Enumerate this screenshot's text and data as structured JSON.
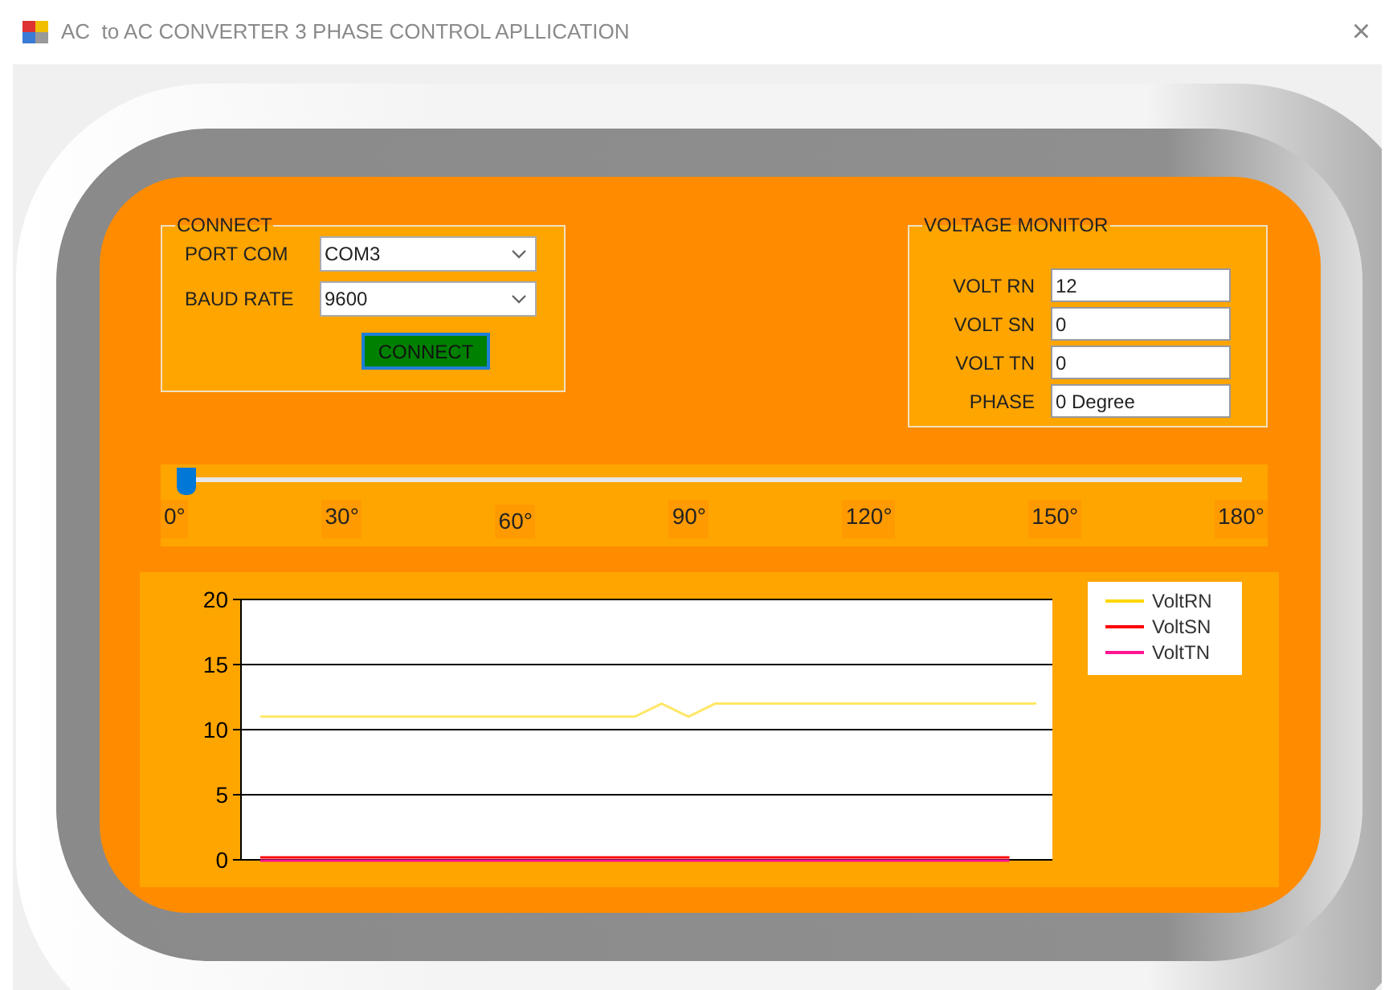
{
  "window": {
    "title": "AC  to AC CONVERTER 3 PHASE CONTROL APLLICATION",
    "close": "×"
  },
  "connect": {
    "title": "CONNECT",
    "fields": [
      {
        "label": "PORT COM",
        "value": "COM3"
      },
      {
        "label": "BAUD RATE",
        "value": "9600"
      }
    ],
    "button": "CONNECT"
  },
  "voltage_monitor": {
    "title": "VOLTAGE MONITOR",
    "fields": [
      {
        "label": "VOLT RN",
        "value": "12"
      },
      {
        "label": "VOLT SN",
        "value": "0"
      },
      {
        "label": "VOLT TN",
        "value": "0"
      },
      {
        "label": "PHASE",
        "value": "0 Degree"
      }
    ]
  },
  "phase_slider": {
    "level": 0,
    "ticks": [
      "0°",
      "30°",
      "60°",
      "90°",
      "120°",
      "150°",
      "180°"
    ]
  },
  "chart": {
    "chart_data": {
      "type": "line",
      "ylim": [
        0,
        20
      ],
      "yticks": [
        0,
        5,
        10,
        15,
        20
      ],
      "grid": true,
      "legend": true,
      "series": [
        {
          "name": "VoltRN",
          "color": "#ffd700",
          "values": [
            11,
            11,
            11,
            11,
            11,
            11,
            11,
            11,
            11,
            11,
            11,
            11,
            11,
            11,
            11,
            12,
            11,
            12,
            12,
            12,
            12,
            12,
            12,
            12,
            12,
            12,
            12,
            12,
            12,
            12
          ]
        },
        {
          "name": "VoltSN",
          "color": "#ff0000",
          "values": [
            0,
            0,
            0,
            0,
            0,
            0,
            0,
            0,
            0,
            0,
            0,
            0,
            0,
            0,
            0,
            0,
            0,
            0,
            0,
            0,
            0,
            0,
            0,
            0,
            0,
            0,
            0,
            0,
            0,
            null
          ]
        },
        {
          "name": "VoltTN",
          "color": "#ff1493",
          "values": [
            0,
            0,
            0,
            0,
            0,
            0,
            0,
            0,
            0,
            0,
            0,
            0,
            0,
            0,
            0,
            0,
            0,
            0,
            0,
            0,
            0,
            0,
            0,
            0,
            0,
            0,
            0,
            0,
            0,
            null
          ]
        }
      ]
    }
  }
}
